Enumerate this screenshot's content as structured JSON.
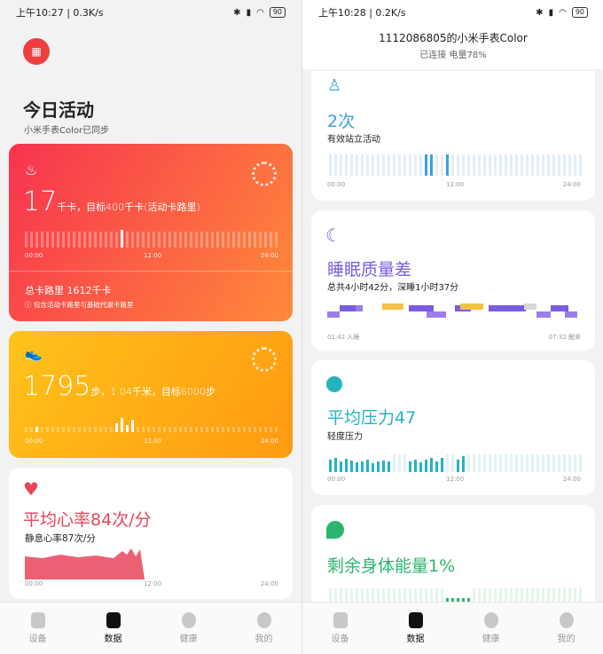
{
  "left": {
    "status": {
      "time": "上午10:27 | 0.3K/s",
      "battery": "90"
    },
    "header": {
      "title": "今日活动",
      "subtitle": "小米手表Color已同步"
    },
    "calories": {
      "value": "17",
      "detail": "千卡，目标400千卡(活动卡路里)",
      "ticks": [
        "00:00",
        "12:00",
        "24:00"
      ],
      "total": "总卡路里  1612千卡",
      "note": "包含活动卡路里与基础代谢卡路里"
    },
    "steps": {
      "value": "1795",
      "detail": "步，1.04千米，目标6000步",
      "ticks": [
        "00:00",
        "12:00",
        "24:00"
      ]
    },
    "heart": {
      "title": "平均心率84次/分",
      "resting": "静息心率87次/分",
      "ticks": [
        "00:00",
        "12:00",
        "24:00"
      ]
    },
    "nav": [
      "设备",
      "数据",
      "健康",
      "我的"
    ]
  },
  "right": {
    "status": {
      "time": "上午10:28 | 0.2K/s",
      "battery": "90"
    },
    "header": {
      "device": "1112086805的小米手表Color",
      "status": "已连接  电量78%"
    },
    "stand": {
      "title": "2次",
      "subtitle": "有效站立活动",
      "ticks": [
        "00:00",
        "12:00",
        "24:00"
      ]
    },
    "sleep": {
      "title": "睡眠质量差",
      "subtitle": "总共4小时42分，深睡1小时37分",
      "start": "01:42 入睡",
      "end": "07:32 醒来"
    },
    "stress": {
      "title": "平均压力47",
      "subtitle": "轻度压力",
      "ticks": [
        "00:00",
        "12:00",
        "24:00"
      ]
    },
    "energy": {
      "title": "剩余身体能量1%"
    },
    "nav": [
      "设备",
      "数据",
      "健康",
      "我的"
    ]
  },
  "colors": {
    "calorie_card": "#f0454f",
    "steps_card": "#ffb400",
    "heart": "#e8455a",
    "stand": "#3aa0e0",
    "sleep": "#7b5ce0",
    "stress": "#25b3c0",
    "energy": "#2db56e"
  }
}
